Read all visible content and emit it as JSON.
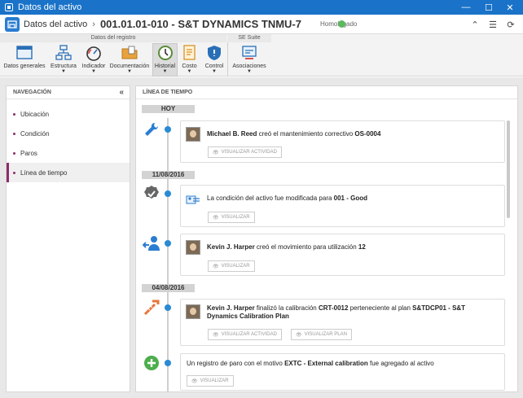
{
  "window": {
    "title": "Datos del activo"
  },
  "header": {
    "crumb": "Datos del activo",
    "separator": "›",
    "record": "001.01.01-010 - S&T DYNAMICS TNMU-7",
    "status": "Homologado"
  },
  "ribbon": {
    "groups": [
      "Datos del registro",
      "SE Suite"
    ],
    "buttons": [
      {
        "label": "Datos generales",
        "icon": "window-icon",
        "dropdown": false
      },
      {
        "label": "Estructura",
        "icon": "structure-icon",
        "dropdown": true
      },
      {
        "label": "Indicador",
        "icon": "gauge-icon",
        "dropdown": true
      },
      {
        "label": "Documentación",
        "icon": "folder-icon",
        "dropdown": true
      },
      {
        "label": "Historial",
        "icon": "clock-icon",
        "dropdown": true,
        "active": true
      },
      {
        "label": "Costo",
        "icon": "invoice-icon",
        "dropdown": true
      },
      {
        "label": "Control",
        "icon": "shield-icon",
        "dropdown": true
      },
      {
        "label": "Asociaciones",
        "icon": "associations-icon",
        "dropdown": true
      }
    ]
  },
  "nav": {
    "title": "NAVEGACIÓN",
    "collapse": "«",
    "items": [
      {
        "label": "Ubicación"
      },
      {
        "label": "Condición"
      },
      {
        "label": "Paros"
      },
      {
        "label": "Línea de tiempo",
        "active": true
      }
    ]
  },
  "timeline": {
    "title": "LÍNEA DE TIEMPO",
    "dates": [
      "HOY",
      "11/08/2016",
      "04/08/2016"
    ],
    "entries": [
      {
        "icon": "wrench-icon",
        "actor": "Michael B. Reed",
        "text": " creó el mantenimiento correctivo ",
        "ref": "OS-0004",
        "buttons": [
          "VISUALIZAR ACTIVIDAD"
        ]
      },
      {
        "icon": "badge-check-icon",
        "actor": "",
        "text": "La condición del activo fue modificada para ",
        "ref": "001 - Good",
        "buttons": [
          "VISUALIZAR"
        ]
      },
      {
        "icon": "user-move-icon",
        "actor": "Kevin J. Harper",
        "text": " creó el movimiento para utilización ",
        "ref": "12",
        "buttons": [
          "VISUALIZAR"
        ]
      },
      {
        "icon": "calibration-icon",
        "actor": "Kevin J. Harper",
        "text": " finalizó la calibración ",
        "ref": "CRT-0012",
        "text2": " perteneciente al plan ",
        "ref2_line1": "S&TDCP01 - S&T",
        "ref2_line2": "Dynamics Calibration Plan",
        "buttons": [
          "VISUALIZAR ACTIVIDAD",
          "VISUALIZAR PLAN"
        ]
      },
      {
        "icon": "plus-circle-icon",
        "actor": "",
        "text": "Un registro de paro con el motivo ",
        "ref": "EXTC - External calibration",
        "text2": " fue agregado al activo",
        "buttons": [
          "VISUALIZAR"
        ]
      }
    ]
  }
}
